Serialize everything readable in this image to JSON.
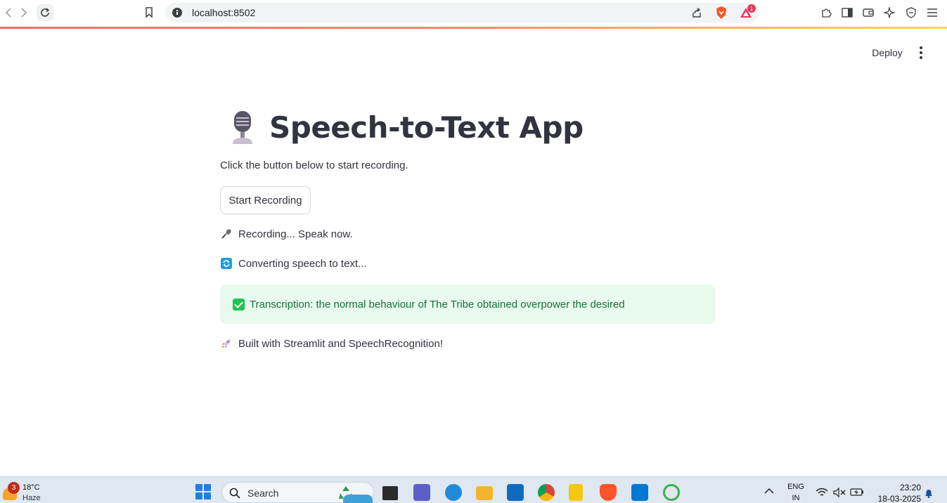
{
  "browser": {
    "url": "localhost:8502",
    "notification_count": "1"
  },
  "header": {
    "deploy_label": "Deploy"
  },
  "main": {
    "title": "Speech-to-Text App",
    "subtitle": "Click the button below to start recording.",
    "start_button_label": "Start Recording",
    "status_recording": "Recording... Speak now.",
    "status_converting": "Converting speech to text...",
    "transcription": "Transcription: the normal behaviour of The Tribe obtained overpower the desired",
    "footer": "Built with Streamlit and SpeechRecognition!"
  },
  "taskbar": {
    "weather_temp": "18°C",
    "weather_desc": "Haze",
    "weather_badge": "3",
    "search_placeholder": "Search",
    "lang_line1": "ENG",
    "lang_line2": "IN",
    "time": "23:20",
    "date": "18-03-2025"
  },
  "icons": {
    "mic": "studio-microphone-icon",
    "recording": "microphone-icon",
    "converting": "arrows-counterclockwise-icon",
    "success": "check-mark-button-icon",
    "footer": "rocket-icon"
  },
  "colors": {
    "success_bg": "#e8f9ee",
    "success_text": "#177233",
    "text": "#31333f"
  }
}
